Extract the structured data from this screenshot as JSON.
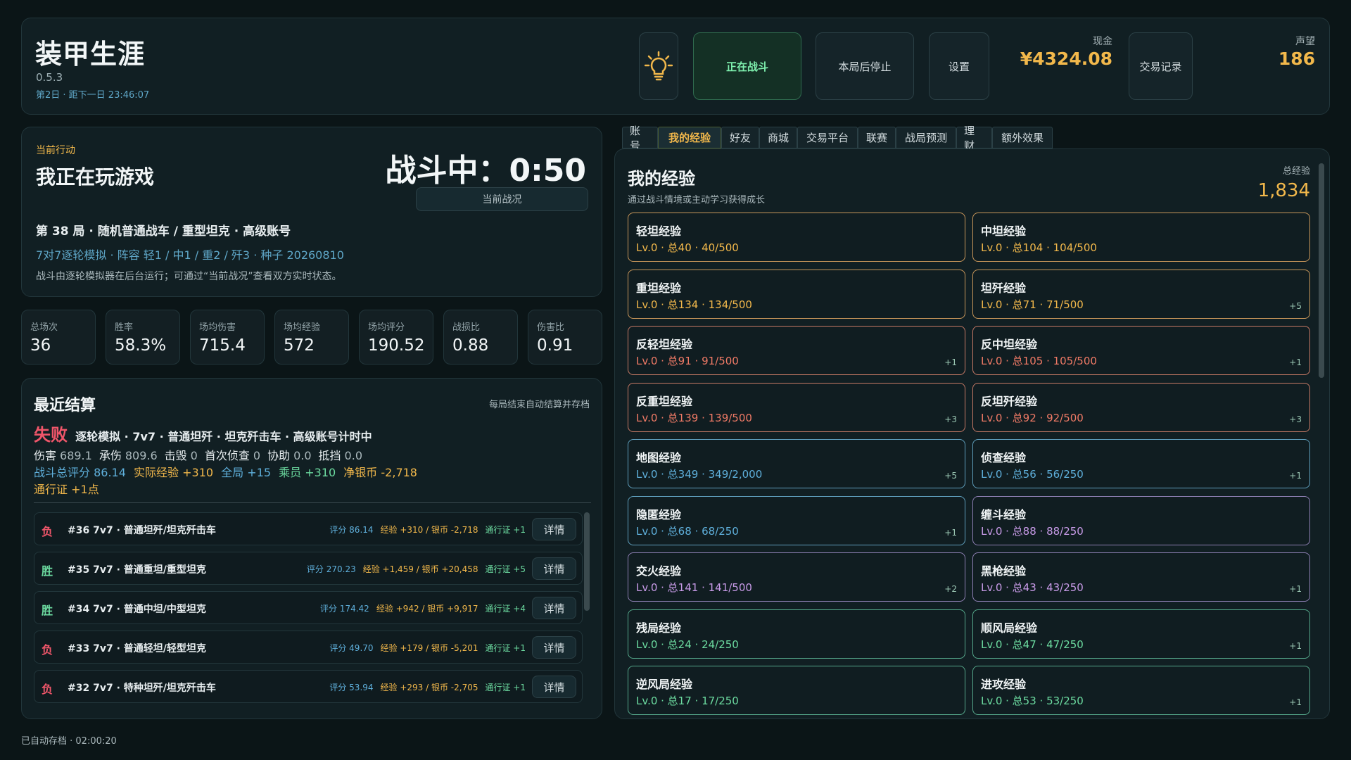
{
  "header": {
    "title": "装甲生涯",
    "version": "0.5.3",
    "date_line": "第2日 · 距下一日 23:46:07",
    "btn_fighting": "正在战斗",
    "btn_stop": "本局后停止",
    "btn_settings": "设置",
    "cash_label": "现金",
    "cash_value": "¥4324.08",
    "btn_trade": "交易记录",
    "rep_label": "声望",
    "rep_value": "186"
  },
  "action": {
    "label": "当前行动",
    "title": "我正在玩游戏",
    "timer": "战斗中：0:50",
    "btn_situation": "当前战况",
    "match_line": "第 38 局 · 随机普通战车 / 重型坦克 · 高级账号",
    "match_sub": "7对7逐轮模拟 · 阵容 轻1 / 中1 / 重2 / 歼3 · 种子 20260810",
    "note": "战斗由逐轮模拟器在后台运行；可通过“当前战况”查看双方实时状态。"
  },
  "stats": [
    {
      "label": "总场次",
      "value": "36"
    },
    {
      "label": "胜率",
      "value": "58.3%"
    },
    {
      "label": "场均伤害",
      "value": "715.4"
    },
    {
      "label": "场均经验",
      "value": "572"
    },
    {
      "label": "场均评分",
      "value": "190.52"
    },
    {
      "label": "战损比",
      "value": "0.88"
    },
    {
      "label": "伤害比",
      "value": "0.91"
    }
  ],
  "recent": {
    "title": "最近结算",
    "note": "每局结束自动结算并存档",
    "last": {
      "result": "失败",
      "desc": "逐轮模拟 · 7v7 · 普通坦歼 · 坦克歼击车 · 高级账号计时中",
      "line2": [
        {
          "k": "伤害",
          "v": "689.1"
        },
        {
          "k": "承伤",
          "v": "809.6"
        },
        {
          "k": "击毁",
          "v": "0"
        },
        {
          "k": "首次侦查",
          "v": "0"
        },
        {
          "k": "协助",
          "v": "0.0"
        },
        {
          "k": "抵挡",
          "v": "0.0"
        }
      ],
      "score_k": "战斗总评分",
      "score_v": "86.14",
      "exp_k": "实际经验",
      "exp_v": "+310",
      "global_k": "全局",
      "global_v": "+15",
      "crew_k": "乘员",
      "crew_v": "+310",
      "silver_k": "净银币",
      "silver_v": "-2,718",
      "pass_k": "通行证",
      "pass_v": "+1点"
    },
    "detail_label": "详情",
    "rows": [
      {
        "res": "负",
        "name": "#36  7v7 · 普通坦歼/坦克歼击车",
        "score": "评分 86.14",
        "gain": "经验 +310 / 银币 -2,718",
        "pass": "通行证 +1"
      },
      {
        "res": "胜",
        "name": "#35  7v7 · 普通重坦/重型坦克",
        "score": "评分 270.23",
        "gain": "经验 +1,459 / 银币 +20,458",
        "pass": "通行证 +5"
      },
      {
        "res": "胜",
        "name": "#34  7v7 · 普通中坦/中型坦克",
        "score": "评分 174.42",
        "gain": "经验 +942 / 银币 +9,917",
        "pass": "通行证 +4"
      },
      {
        "res": "负",
        "name": "#33  7v7 · 普通轻坦/轻型坦克",
        "score": "评分 49.70",
        "gain": "经验 +179 / 银币 -5,201",
        "pass": "通行证 +1"
      },
      {
        "res": "负",
        "name": "#32  7v7 · 特种坦歼/坦克歼击车",
        "score": "评分 53.94",
        "gain": "经验 +293 / 银币 -2,705",
        "pass": "通行证 +1"
      }
    ]
  },
  "tabs": [
    "账号",
    "我的经验",
    "好友",
    "商城",
    "交易平台",
    "联赛",
    "战局预测",
    "理财",
    "额外效果"
  ],
  "exp": {
    "title": "我的经验",
    "subtitle": "通过战斗情境或主动学习获得成长",
    "total_label": "总经验",
    "total_value": "1,834",
    "cards": [
      {
        "name": "轻坦经验",
        "value": "Lv.0 · 总40 · 40/500",
        "bonus": "",
        "tone": "lt"
      },
      {
        "name": "中坦经验",
        "value": "Lv.0 · 总104 · 104/500",
        "bonus": "",
        "tone": "lt"
      },
      {
        "name": "重坦经验",
        "value": "Lv.0 · 总134 · 134/500",
        "bonus": "",
        "tone": "lt"
      },
      {
        "name": "坦歼经验",
        "value": "Lv.0 · 总71 · 71/500",
        "bonus": "+5",
        "tone": "lt"
      },
      {
        "name": "反轻坦经验",
        "value": "Lv.0 · 总91 · 91/500",
        "bonus": "+1",
        "tone": "rd"
      },
      {
        "name": "反中坦经验",
        "value": "Lv.0 · 总105 · 105/500",
        "bonus": "+1",
        "tone": "rd"
      },
      {
        "name": "反重坦经验",
        "value": "Lv.0 · 总139 · 139/500",
        "bonus": "+3",
        "tone": "rd"
      },
      {
        "name": "反坦歼经验",
        "value": "Lv.0 · 总92 · 92/500",
        "bonus": "+3",
        "tone": "rd"
      },
      {
        "name": "地图经验",
        "value": "Lv.0 · 总349 · 349/2,000",
        "bonus": "+5",
        "tone": "bl"
      },
      {
        "name": "侦查经验",
        "value": "Lv.0 · 总56 · 56/250",
        "bonus": "+1",
        "tone": "bl"
      },
      {
        "name": "隐匿经验",
        "value": "Lv.0 · 总68 · 68/250",
        "bonus": "+1",
        "tone": "bl"
      },
      {
        "name": "缠斗经验",
        "value": "Lv.0 · 总88 · 88/250",
        "bonus": "",
        "tone": "pu"
      },
      {
        "name": "交火经验",
        "value": "Lv.0 · 总141 · 141/500",
        "bonus": "+2",
        "tone": "pu"
      },
      {
        "name": "黑枪经验",
        "value": "Lv.0 · 总43 · 43/250",
        "bonus": "+1",
        "tone": "pu"
      },
      {
        "name": "残局经验",
        "value": "Lv.0 · 总24 · 24/250",
        "bonus": "",
        "tone": "gr"
      },
      {
        "name": "顺风局经验",
        "value": "Lv.0 · 总47 · 47/250",
        "bonus": "+1",
        "tone": "gr"
      },
      {
        "name": "逆风局经验",
        "value": "Lv.0 · 总17 · 17/250",
        "bonus": "",
        "tone": "gr"
      },
      {
        "name": "进攻经验",
        "value": "Lv.0 · 总53 · 53/250",
        "bonus": "+1",
        "tone": "gr"
      }
    ]
  },
  "footer": "已自动存档 · 02:00:20",
  "colors": {
    "accent": "#f2b84b",
    "win": "#6cdba0",
    "lose": "#f0566a",
    "link": "#5fa7c8"
  }
}
